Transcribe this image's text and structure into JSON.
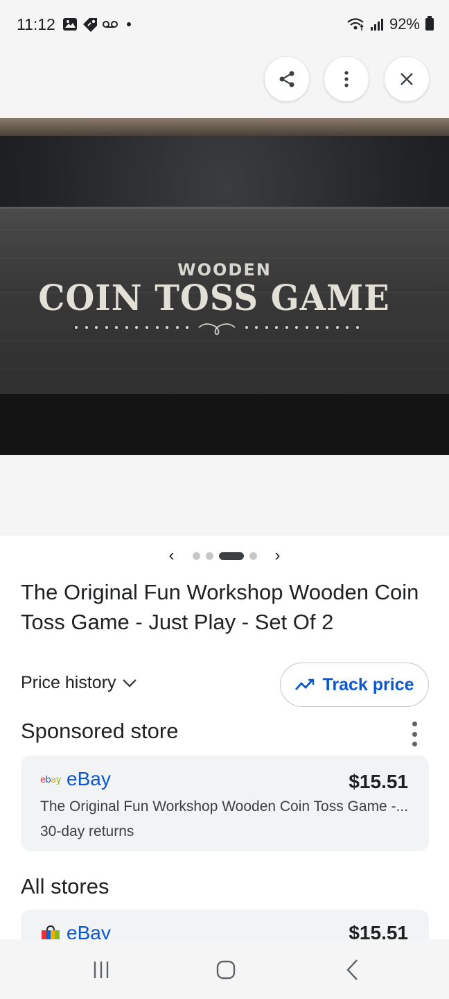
{
  "status_bar": {
    "time": "11:12",
    "battery": "92%",
    "left_icons": [
      "gallery-icon",
      "tag-icon",
      "voicemail-icon",
      "dot-icon"
    ],
    "right_icons": [
      "wifi-icon",
      "signal-icon",
      "battery-icon"
    ]
  },
  "top_actions": {
    "share_icon": "share-icon",
    "more_icon": "more-vert-icon",
    "close_icon": "close-icon"
  },
  "hero_image": {
    "line1": "WOODEN",
    "line2": "COIN TOSS GAME"
  },
  "pager": {
    "prev": "‹",
    "next": "›",
    "total": 4,
    "active_index": 2
  },
  "product": {
    "title": "The Original Fun Workshop Wooden Coin Toss Game - Just Play - Set Of 2"
  },
  "actions": {
    "price_history": "Price history",
    "track_price": "Track price"
  },
  "sponsored": {
    "heading": "Sponsored store",
    "store": {
      "logo_text": "ebay",
      "name": "eBay",
      "price": "$15.51",
      "description": "The Original Fun Workshop Wooden Coin Toss Game -...",
      "returns": "30-day returns"
    }
  },
  "all_stores": {
    "heading": "All stores",
    "stores": [
      {
        "name": "eBay",
        "price": "$15.51"
      }
    ]
  },
  "nav_bar": {
    "recent_icon": "recent-apps-icon",
    "home_icon": "home-icon",
    "back_icon": "back-icon"
  },
  "colors": {
    "link_blue": "#0b57d0",
    "card_bg": "#f1f3f4",
    "page_gray": "#f5f5f5"
  }
}
